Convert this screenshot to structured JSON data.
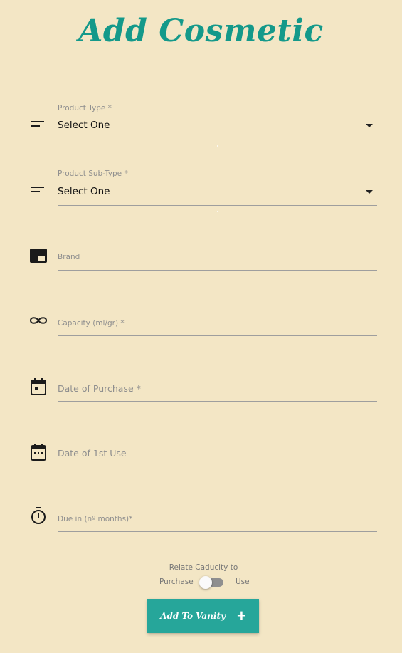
{
  "title": "Add Cosmetic",
  "fields": {
    "product_type": {
      "label": "Product Type *",
      "value": "Select One"
    },
    "product_sub_type": {
      "label": "Product Sub-Type *",
      "value": "Select One"
    },
    "brand": {
      "placeholder": "Brand"
    },
    "capacity": {
      "placeholder": "Capacity (ml/gr) *"
    },
    "date_purchase": {
      "placeholder": "Date of Purchase *"
    },
    "date_first_use": {
      "placeholder": "Date of 1st Use"
    },
    "due_in": {
      "placeholder": "Due in (nº months)*"
    }
  },
  "toggle": {
    "label": "Relate Caducity to",
    "left_option": "Purchase",
    "right_option": "Use",
    "checked": false
  },
  "add_button": {
    "label": "Add To Vanity",
    "icon": "plus-icon"
  },
  "colors": {
    "background": "#f3e6c5",
    "accent": "#14998a",
    "button": "#26a69a"
  }
}
